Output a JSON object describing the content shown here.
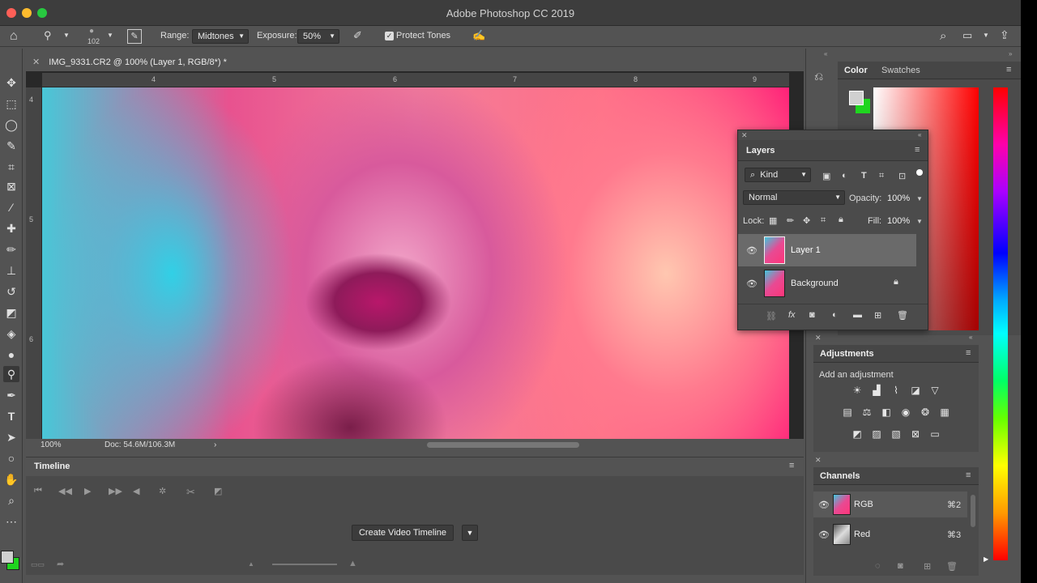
{
  "app": {
    "title": "Adobe Photoshop CC 2019"
  },
  "colors": {
    "accent_green": "#1fd51f",
    "panel_bg": "#4b4b4b",
    "app_bg": "#535353"
  },
  "options_bar": {
    "brush_size": "102",
    "range_label": "Range:",
    "range_value": "Midtones",
    "exposure_label": "Exposure:",
    "exposure_value": "50%",
    "protect_tones_label": "Protect Tones"
  },
  "document": {
    "tab_title": "IMG_9331.CR2 @ 100% (Layer 1, RGB/8*) *",
    "zoom": "100%",
    "doc_size": "Doc: 54.6M/106.3M",
    "ruler_top": [
      "4",
      "5",
      "6",
      "7",
      "8",
      "9"
    ],
    "ruler_left": [
      "4",
      "5",
      "6"
    ]
  },
  "timeline": {
    "title": "Timeline",
    "create_button": "Create Video Timeline"
  },
  "color_panel": {
    "tabs": [
      "Color",
      "Swatches"
    ]
  },
  "layers_panel": {
    "title": "Layers",
    "filter_kind": "Kind",
    "blend_mode": "Normal",
    "opacity_label": "Opacity:",
    "opacity_value": "100%",
    "lock_label": "Lock:",
    "fill_label": "Fill:",
    "fill_value": "100%",
    "layers": [
      {
        "name": "Layer 1"
      },
      {
        "name": "Background"
      }
    ]
  },
  "adjustments_panel": {
    "title": "Adjustments",
    "subtitle": "Add an adjustment"
  },
  "channels_panel": {
    "title": "Channels",
    "channels": [
      {
        "name": "RGB",
        "shortcut": "⌘2"
      },
      {
        "name": "Red",
        "shortcut": "⌘3"
      }
    ]
  }
}
